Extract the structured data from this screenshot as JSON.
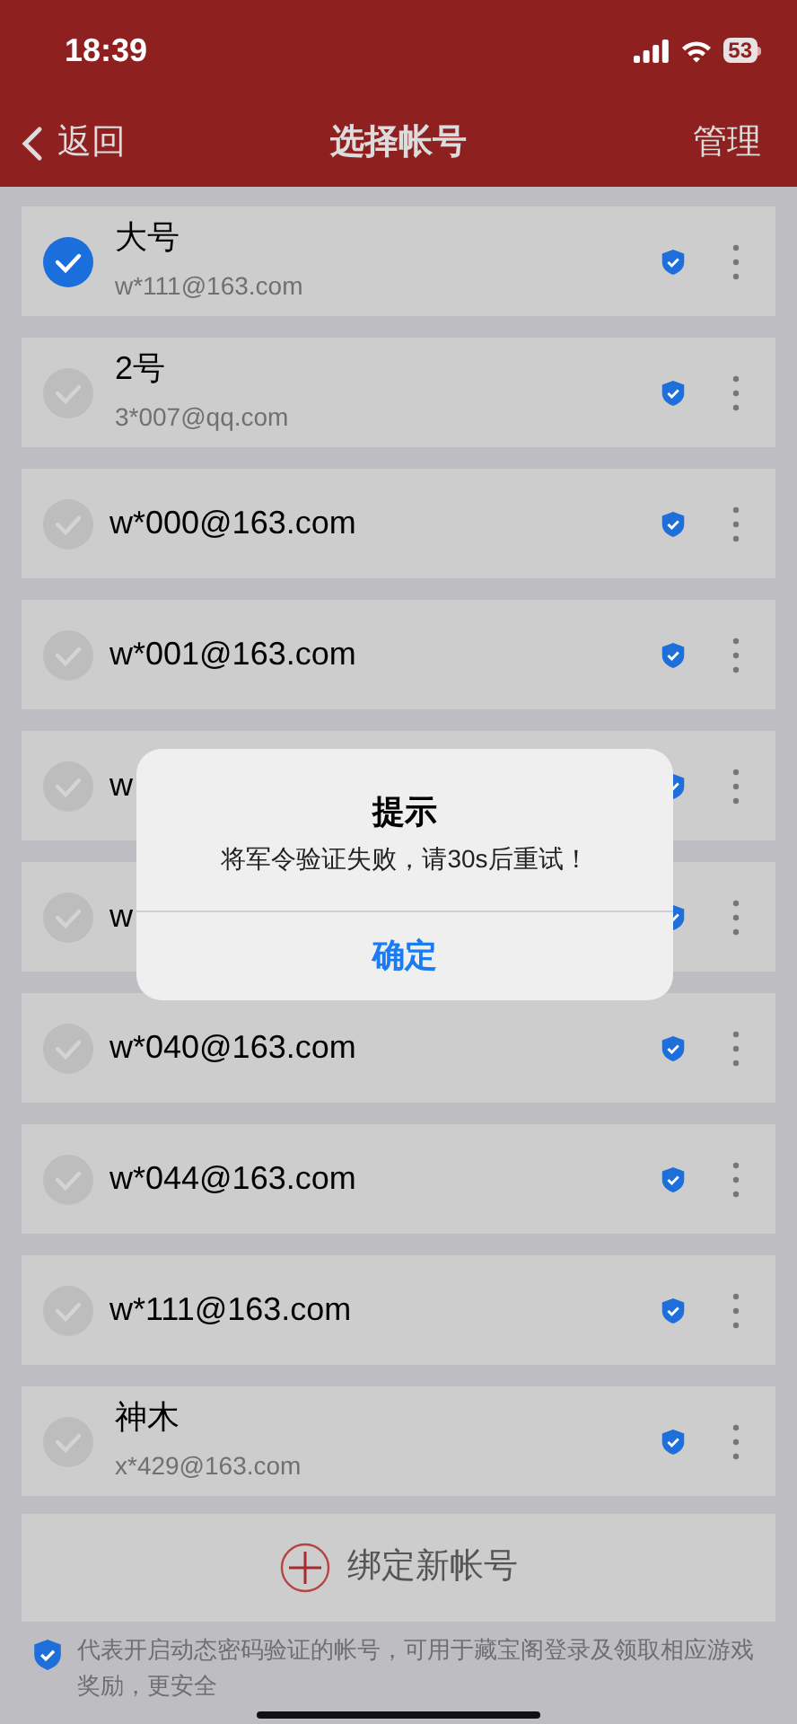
{
  "status_bar": {
    "time": "18:39",
    "battery": "53"
  },
  "nav": {
    "back": "返回",
    "title": "选择帐号",
    "action": "管理"
  },
  "accounts": [
    {
      "title": "大号",
      "subtitle": "w*111@163.com",
      "selected": true
    },
    {
      "title": "2号",
      "subtitle": "3*007@qq.com",
      "selected": false
    },
    {
      "title": "w*000@163.com",
      "selected": false
    },
    {
      "title": "w*001@163.com",
      "selected": false
    },
    {
      "title": "w",
      "selected": false
    },
    {
      "title": "w",
      "selected": false
    },
    {
      "title": "w*040@163.com",
      "selected": false
    },
    {
      "title": "w*044@163.com",
      "selected": false
    },
    {
      "title": "w*111@163.com",
      "selected": false
    },
    {
      "title": "神木",
      "subtitle": "x*429@163.com",
      "selected": false
    }
  ],
  "add_button": "绑定新帐号",
  "footnote": "代表开启动态密码验证的帐号，可用于藏宝阁登录及领取相应游戏奖励，更安全",
  "dialog": {
    "title": "提示",
    "message": "将军令验证失败，请30s后重试！",
    "button": "确定"
  }
}
